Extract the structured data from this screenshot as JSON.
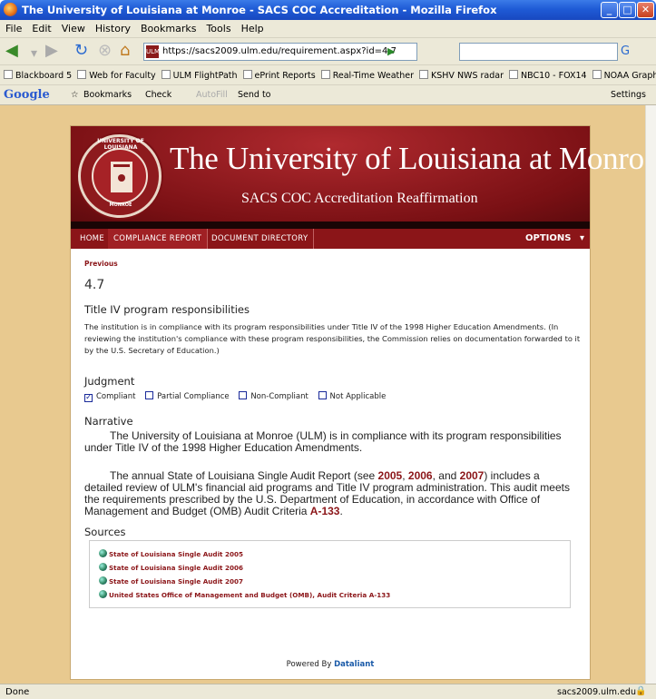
{
  "window": {
    "title": "The University of Louisiana at Monroe - SACS COC Accreditation - Mozilla Firefox"
  },
  "menu": [
    "File",
    "Edit",
    "View",
    "History",
    "Bookmarks",
    "Tools",
    "Help"
  ],
  "url": "https://sacs2009.ulm.edu/requirement.aspx?id=4.7",
  "bookmarks": [
    "Blackboard 5",
    "Web for Faculty",
    "ULM FlightPath",
    "ePrint Reports",
    "Real-Time Weather",
    "KSHV NWS radar",
    "NBC10 - FOX14",
    "NOAA Graphical Fore..."
  ],
  "google_toolbar": {
    "logo": "Google",
    "bookmarks": "Bookmarks",
    "check": "Check",
    "autofill": "AutoFill",
    "send_to": "Send to",
    "settings": "Settings"
  },
  "banner": {
    "university": "The University of Louisiana at Monroe",
    "subtitle": "SACS COC Accreditation Reaffirmation",
    "seal_top": "UNIVERSITY OF LOUISIANA",
    "seal_bottom": "MONROE"
  },
  "nav": {
    "home": "HOME",
    "compliance": "COMPLIANCE REPORT",
    "directory": "DOCUMENT DIRECTORY",
    "options": "OPTIONS"
  },
  "main": {
    "previous": "Previous",
    "number": "4.7",
    "title": "Title IV program responsibilities",
    "intro": "The institution is in compliance with its program responsibilities under Title IV of the 1998 Higher Education Amendments. (In reviewing the institution's compliance with these program responsibilities, the Commission relies on documentation forwarded to it by the U.S. Secretary of Education.)",
    "judgment_heading": "Judgment",
    "judgments": [
      {
        "label": "Compliant",
        "checked": true
      },
      {
        "label": "Partial Compliance",
        "checked": false
      },
      {
        "label": "Non-Compliant",
        "checked": false
      },
      {
        "label": "Not Applicable",
        "checked": false
      }
    ],
    "narrative_heading": "Narrative",
    "para1": "The University of Louisiana at Monroe (ULM) is in compliance with its program responsibilities under Title IV of the 1998 Higher Education Amendments.",
    "para2_a": "The annual State of Louisiana Single Audit Report (see ",
    "link_2005": "2005",
    "sep1": ", ",
    "link_2006": "2006",
    "sep2": ", and ",
    "link_2007": "2007",
    "para2_b": ") includes a detailed review of ULM's financial aid programs and Title IV program administration. This audit meets the requirements prescribed by the U.S. Department of Education, in accordance with Office of Management and Budget (OMB) Audit Criteria ",
    "link_a133": "A-133",
    "para2_end": ".",
    "sources_heading": "Sources",
    "sources": [
      "State of Louisiana Single Audit 2005",
      "State of Louisiana Single Audit 2006",
      "State of Louisiana Single Audit 2007",
      "United States Office of Management and Budget (OMB), Audit Criteria A-133"
    ]
  },
  "footer": {
    "powered": "Powered By ",
    "brand": "Dataliant"
  },
  "status": {
    "text": "Done",
    "host": "sacs2009.ulm.edu"
  }
}
